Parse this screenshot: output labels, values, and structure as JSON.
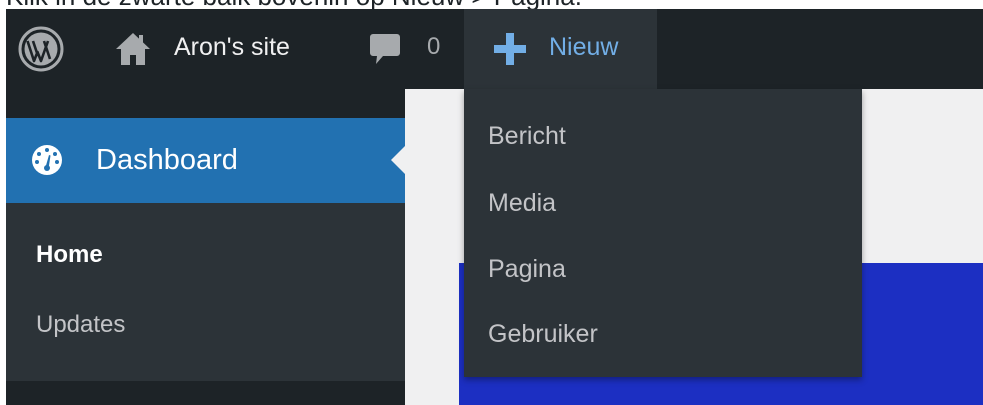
{
  "caption": {
    "text": "Klik in de zwarte balk bovenin op Nieuw > Pagina."
  },
  "adminbar": {
    "site_name": "Aron's site",
    "comment_count": "0",
    "new_label": "Nieuw"
  },
  "sidebar": {
    "dashboard_label": "Dashboard",
    "submenu": {
      "home": "Home",
      "updates": "Updates"
    }
  },
  "new_menu": {
    "items": [
      "Bericht",
      "Media",
      "Pagina",
      "Gebruiker"
    ]
  },
  "colors": {
    "adminbar_bg": "#1d2327",
    "submenu_bg": "#2c3338",
    "accent_blue": "#2271b1",
    "link_blue": "#72aee6",
    "content_bg": "#f0f0f1",
    "block_blue": "#1c2fc2"
  },
  "icons": {
    "wp_logo": "wordpress-logo-icon",
    "home": "home-icon",
    "comments": "comment-bubble-icon",
    "new": "plus-icon",
    "dashboard": "dashboard-gauge-icon"
  }
}
